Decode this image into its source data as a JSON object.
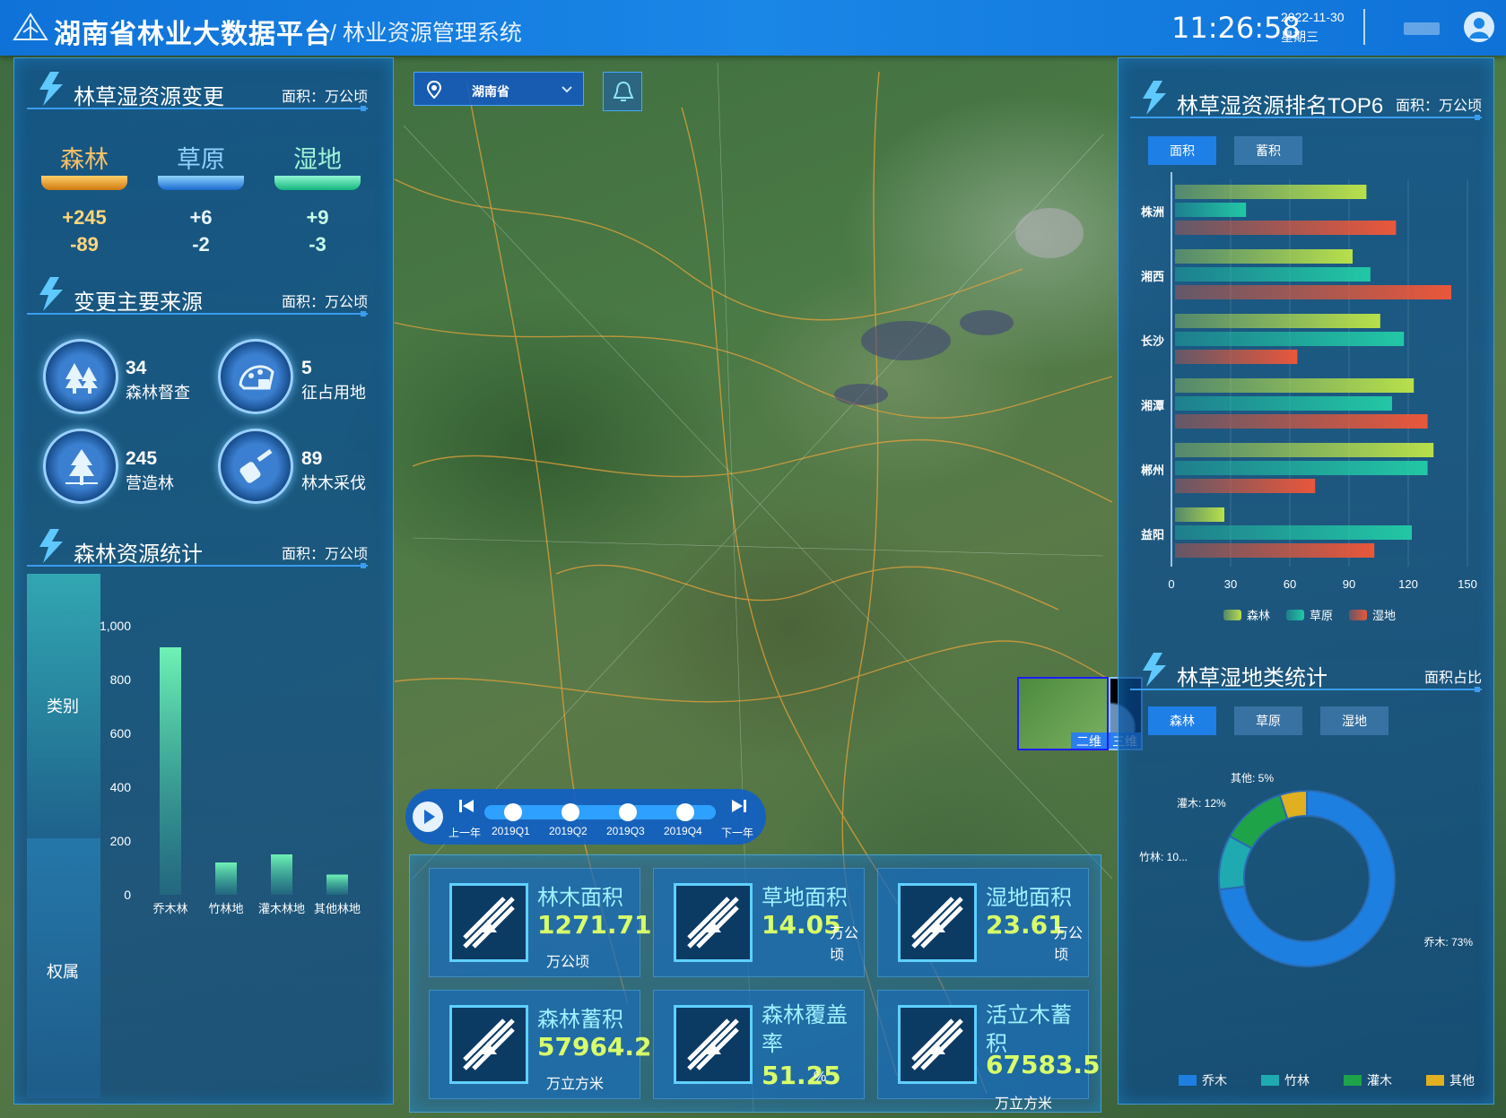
{
  "header": {
    "app_title": "湖南省林业大数据平台",
    "subtitle": "/ 林业资源管理系统",
    "time": "11:26:58",
    "date": "2022-11-30",
    "weekday": "星期三"
  },
  "change": {
    "title": "林草湿资源变更",
    "unit": "面积：万公顷",
    "categories": [
      {
        "label": "森林",
        "plus": "+245",
        "minus": "-89",
        "color": "#f0a030"
      },
      {
        "label": "草原",
        "plus": "+6",
        "minus": "-2",
        "color": "#2f8fe8"
      },
      {
        "label": "湿地",
        "plus": "+9",
        "minus": "-3",
        "color": "#27d7a8"
      }
    ]
  },
  "sources": {
    "title": "变更主要来源",
    "unit": "面积：万公顷",
    "items": [
      {
        "value": "34",
        "label": "森林督查",
        "icon": "forest-icon"
      },
      {
        "value": "5",
        "label": "征占用地",
        "icon": "land-icon"
      },
      {
        "value": "245",
        "label": "营造林",
        "icon": "planting-icon"
      },
      {
        "value": "89",
        "label": "林木采伐",
        "icon": "logging-icon"
      }
    ]
  },
  "forest_stats": {
    "title": "森林资源统计",
    "unit": "面积：万公顷",
    "side_tabs": [
      "类别",
      "权属"
    ]
  },
  "map": {
    "region": "湖南省",
    "minimap_labels": [
      "二维",
      "三维"
    ]
  },
  "timeline": {
    "prev": "上一年",
    "next": "下一年",
    "quarters": [
      "2019Q1",
      "2019Q2",
      "2019Q3",
      "2019Q4"
    ]
  },
  "stats": [
    {
      "name": "林木面积",
      "value": "1271.71",
      "unit": "万公顷"
    },
    {
      "name": "草地面积",
      "value": "14.05",
      "unit": "万公顷"
    },
    {
      "name": "湿地面积",
      "value": "23.61",
      "unit": "万公顷"
    },
    {
      "name": "森林蓄积",
      "value": "57964.2",
      "unit": "万立方米"
    },
    {
      "name": "森林覆盖率",
      "value": "51.25",
      "unit": "%"
    },
    {
      "name": "活立木蓄积",
      "value": "67583.5",
      "unit": "万立方米"
    }
  ],
  "ranking": {
    "title": "林草湿资源排名TOP6",
    "unit": "面积：万公顷",
    "tabs": [
      "面积",
      "蓄积"
    ]
  },
  "landclass": {
    "title": "林草湿地类统计",
    "unit": "面积占比",
    "tabs": [
      "森林",
      "草原",
      "湿地"
    ]
  },
  "chart_data": [
    {
      "type": "bar",
      "categories": [
        "乔木林",
        "竹林地",
        "灌木林地",
        "其他林地"
      ],
      "values": [
        920,
        120,
        150,
        75
      ],
      "ylim": [
        0,
        1000
      ],
      "yticks": [
        0,
        200,
        400,
        600,
        800,
        1000
      ]
    },
    {
      "type": "bar",
      "orientation": "horizontal",
      "categories": [
        "株洲",
        "湘西",
        "长沙",
        "湘潭",
        "郴州",
        "益阳"
      ],
      "series": [
        {
          "name": "森林",
          "color": "#b8e04a",
          "values": [
            97,
            90,
            104,
            121,
            131,
            25
          ]
        },
        {
          "name": "草原",
          "color": "#22c7a5",
          "values": [
            36,
            99,
            116,
            110,
            128,
            120
          ]
        },
        {
          "name": "湿地",
          "color": "#e9573a",
          "values": [
            112,
            140,
            62,
            128,
            71,
            101
          ]
        }
      ],
      "xlim": [
        0,
        150
      ],
      "xticks": [
        0,
        30,
        60,
        90,
        120,
        150
      ]
    },
    {
      "type": "pie",
      "donut": true,
      "slices": [
        {
          "name": "乔木",
          "value": 73,
          "label": "乔木: 73%",
          "color": "#1d7fe0"
        },
        {
          "name": "竹林",
          "value": 10,
          "label": "竹林: 10...",
          "color": "#1eaab0"
        },
        {
          "name": "灌木",
          "value": 12,
          "label": "灌木: 12%",
          "color": "#1fa349"
        },
        {
          "name": "其他",
          "value": 5,
          "label": "其他: 5%",
          "color": "#e0b020"
        }
      ]
    }
  ]
}
